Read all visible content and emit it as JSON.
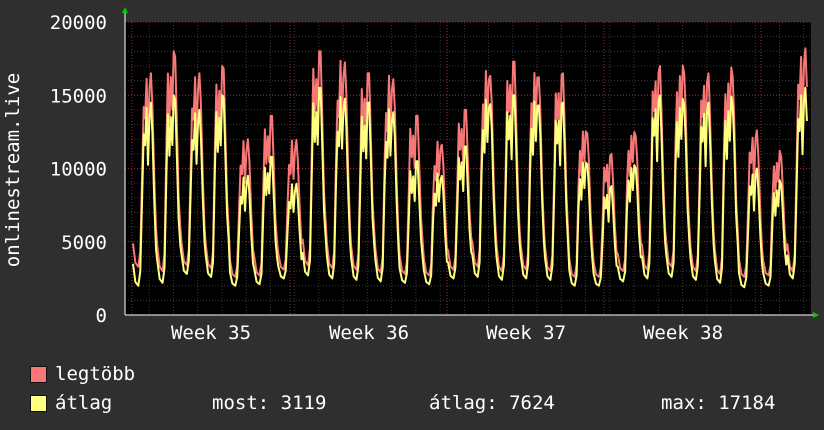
{
  "chart_data": {
    "type": "line",
    "ylabel": "onlinestream.live",
    "ylim": [
      0,
      20000
    ],
    "y_ticks": [
      "0",
      "5000",
      "10000",
      "15000",
      "20000"
    ],
    "x_ticks": [
      "Week 35",
      "Week 36",
      "Week 37",
      "Week 38"
    ],
    "grid": true,
    "legend_placement": "bottom-left",
    "series": [
      {
        "name": "legtöbb",
        "color": "#f87878",
        "daily_night_min": [
          3300,
          3000,
          3400,
          3200,
          2600,
          2700,
          3100,
          3400,
          3200,
          3100,
          2900,
          2800,
          2700,
          3100,
          3300,
          3000,
          3100,
          3000,
          2600,
          2600,
          3000,
          3100,
          3300,
          3000,
          2800,
          2600,
          2700,
          3000
        ],
        "daily_peak": [
          16500,
          18000,
          16500,
          17000,
          12000,
          13600,
          12000,
          18000,
          17500,
          16500,
          16500,
          13600,
          12000,
          14000,
          17000,
          17300,
          17000,
          16500,
          13000,
          11000,
          12800,
          17000,
          17300,
          16500,
          17000,
          12600,
          11200,
          18200
        ]
      },
      {
        "name": "átlag",
        "color": "#ffff80",
        "daily_night_min": [
          2000,
          2200,
          2800,
          2600,
          2000,
          2100,
          2500,
          2700,
          2500,
          2400,
          2300,
          2200,
          2100,
          2500,
          2600,
          2400,
          2500,
          2400,
          2000,
          2000,
          2300,
          2500,
          2600,
          2400,
          2200,
          1900,
          2000,
          2500
        ],
        "daily_peak": [
          14500,
          15000,
          14000,
          15000,
          9500,
          10800,
          9000,
          15500,
          15000,
          14500,
          14200,
          10500,
          9800,
          11500,
          15000,
          15000,
          15000,
          14500,
          10800,
          8800,
          10500,
          15000,
          15000,
          14500,
          15000,
          10000,
          9200,
          15500
        ]
      }
    ]
  },
  "legend": {
    "items": [
      {
        "label": "legtöbb",
        "color": "#f87878"
      },
      {
        "label": "átlag",
        "color": "#ffff80"
      }
    ]
  },
  "stats": {
    "most": "most: 3119",
    "atlag": "átlag: 7624",
    "max": "max: 17184"
  }
}
